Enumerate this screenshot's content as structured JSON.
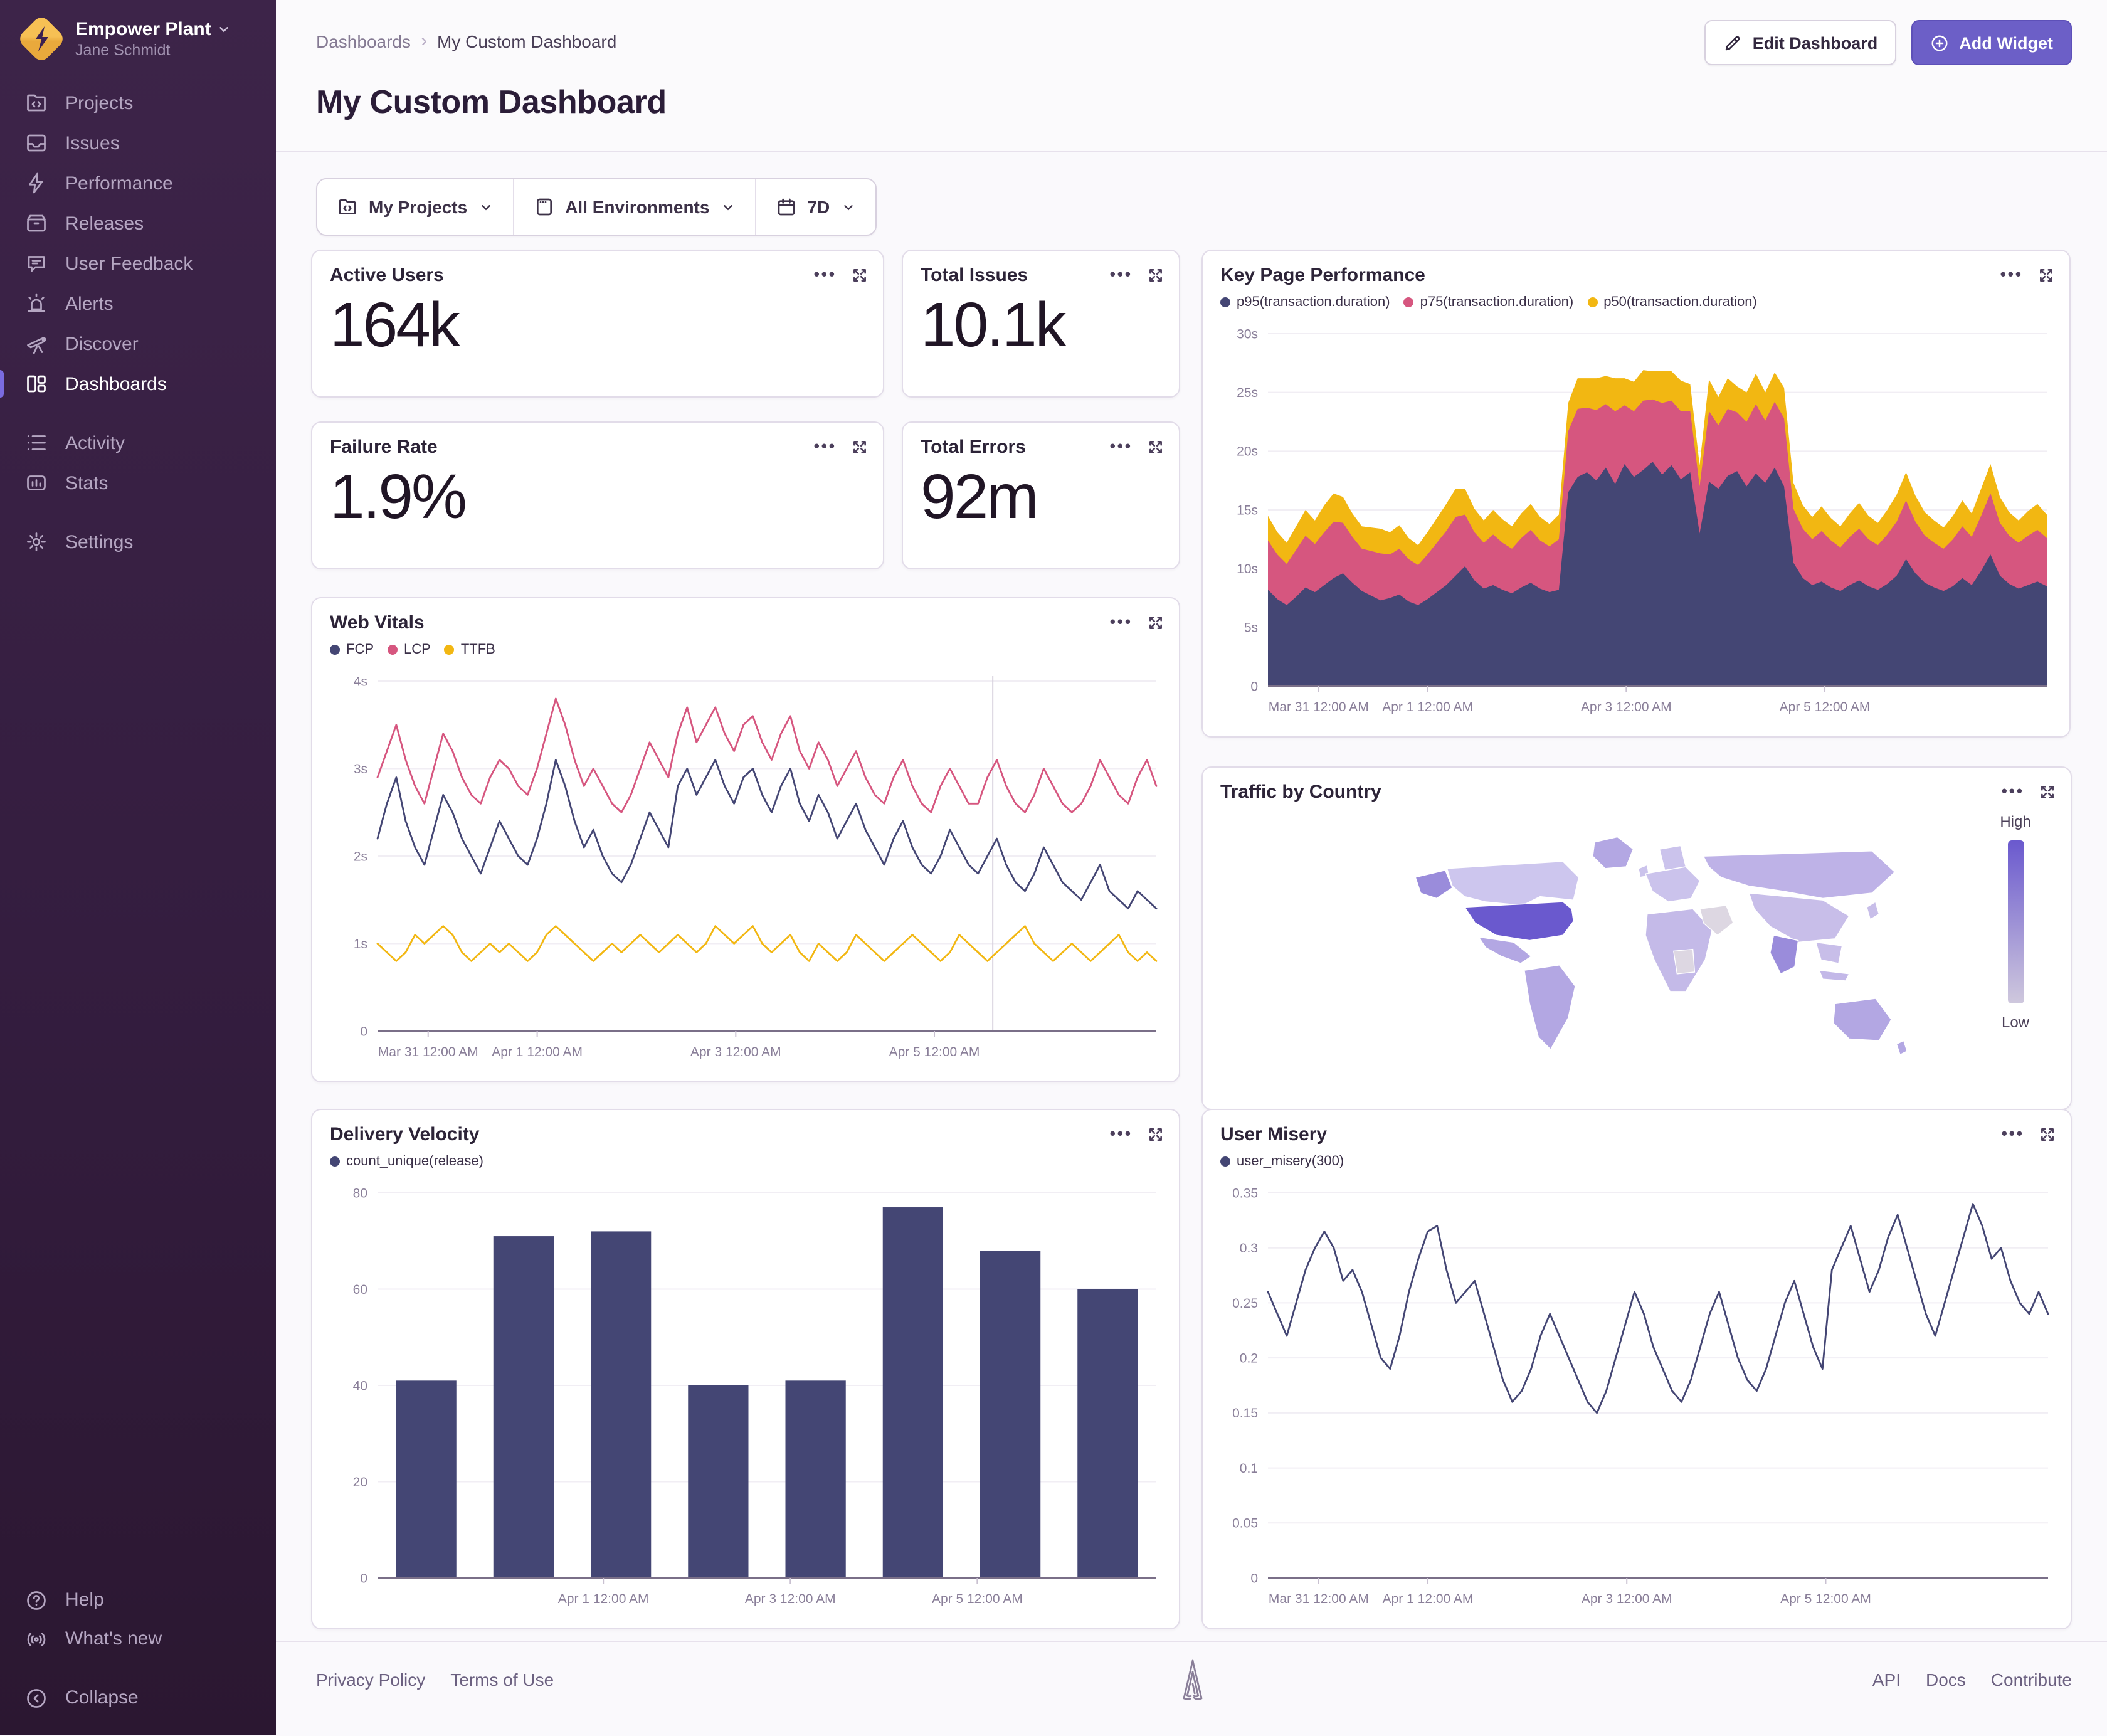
{
  "sidebar": {
    "org": {
      "name": "Empower Plant",
      "user": "Jane Schmidt"
    },
    "groups": [
      {
        "items": [
          {
            "id": "projects",
            "label": "Projects",
            "icon": "projects",
            "active": false
          },
          {
            "id": "issues",
            "label": "Issues",
            "icon": "issues",
            "active": false
          },
          {
            "id": "performance",
            "label": "Performance",
            "icon": "performance",
            "active": false
          },
          {
            "id": "releases",
            "label": "Releases",
            "icon": "releases",
            "active": false
          },
          {
            "id": "user-feedback",
            "label": "User Feedback",
            "icon": "feedback",
            "active": false
          },
          {
            "id": "alerts",
            "label": "Alerts",
            "icon": "alerts",
            "active": false
          },
          {
            "id": "discover",
            "label": "Discover",
            "icon": "discover",
            "active": false
          },
          {
            "id": "dashboards",
            "label": "Dashboards",
            "icon": "dashboards",
            "active": true
          }
        ]
      },
      {
        "items": [
          {
            "id": "activity",
            "label": "Activity",
            "icon": "activity",
            "active": false
          },
          {
            "id": "stats",
            "label": "Stats",
            "icon": "stats",
            "active": false
          }
        ]
      },
      {
        "items": [
          {
            "id": "settings",
            "label": "Settings",
            "icon": "settings",
            "active": false
          }
        ]
      }
    ],
    "bottom": [
      {
        "id": "help",
        "label": "Help",
        "icon": "help"
      },
      {
        "id": "whats-new",
        "label": "What's new",
        "icon": "broadcast"
      },
      {
        "id": "collapse",
        "label": "Collapse",
        "icon": "collapse"
      }
    ]
  },
  "header": {
    "breadcrumb_root": "Dashboards",
    "breadcrumb_current": "My Custom Dashboard",
    "title": "My Custom Dashboard",
    "edit_button": "Edit Dashboard",
    "add_button": "Add Widget"
  },
  "filters": {
    "projects": "My Projects",
    "environments": "All Environments",
    "period": "7D"
  },
  "stats": [
    {
      "title": "Active Users",
      "value": "164k"
    },
    {
      "title": "Total Issues",
      "value": "10.1k"
    },
    {
      "title": "Failure Rate",
      "value": "1.9%"
    },
    {
      "title": "Total Errors",
      "value": "92m"
    }
  ],
  "colors": {
    "accent": "#6C5FC7",
    "navy": "#444674",
    "pink": "#D6567F",
    "yellow": "#F2B712"
  },
  "footer": {
    "left": [
      "Privacy Policy",
      "Terms of Use"
    ],
    "right": [
      "API",
      "Docs",
      "Contribute"
    ]
  },
  "chart_data": [
    {
      "id": "key-page-performance",
      "type": "area",
      "stacked": true,
      "title": "Key Page Performance",
      "ylim": [
        0,
        30
      ],
      "yticks": [
        {
          "v": 0,
          "label": "0"
        },
        {
          "v": 5,
          "label": "5s"
        },
        {
          "v": 10,
          "label": "10s"
        },
        {
          "v": 15,
          "label": "15s"
        },
        {
          "v": 20,
          "label": "20s"
        },
        {
          "v": 25,
          "label": "25s"
        },
        {
          "v": 30,
          "label": "30s"
        }
      ],
      "xticks": [
        {
          "pos": 0.065,
          "label": "Mar 31 12:00 AM"
        },
        {
          "pos": 0.205,
          "label": "Apr 1 12:00 AM"
        },
        {
          "pos": 0.46,
          "label": "Apr 3 12:00 AM"
        },
        {
          "pos": 0.715,
          "label": "Apr 5 12:00 AM"
        }
      ],
      "series": [
        {
          "name": "p95(transaction.duration)",
          "color": "#444674",
          "values": [
            8.2,
            7.4,
            6.9,
            7.6,
            8.4,
            8.0,
            8.6,
            9.2,
            9.6,
            8.8,
            8.1,
            7.7,
            7.3,
            7.5,
            7.8,
            7.2,
            6.9,
            7.4,
            8.0,
            8.6,
            9.4,
            10.2,
            9.0,
            8.3,
            8.6,
            8.2,
            7.9,
            8.4,
            8.8,
            8.3,
            8.0,
            8.2,
            16.5,
            17.8,
            18.2,
            17.5,
            18.6,
            17.2,
            18.9,
            17.8,
            18.4,
            19.1,
            18.0,
            18.8,
            17.6,
            18.2,
            13.0,
            17.4,
            16.8,
            17.9,
            18.3,
            17.0,
            18.1,
            17.3,
            18.6,
            17.0,
            10.5,
            9.2,
            8.6,
            8.9,
            8.4,
            8.1,
            8.6,
            9.0,
            8.5,
            8.2,
            8.7,
            9.4,
            10.8,
            9.6,
            8.8,
            8.4,
            8.1,
            8.5,
            9.2,
            8.6,
            9.8,
            11.2,
            9.4,
            8.7,
            8.3,
            8.6,
            8.9,
            8.5
          ]
        },
        {
          "name": "p75(transaction.duration)",
          "color": "#D6567F",
          "values": [
            4.2,
            3.8,
            3.5,
            4.0,
            4.4,
            4.1,
            4.5,
            4.8,
            4.3,
            3.9,
            3.6,
            3.8,
            4.0,
            3.7,
            3.9,
            3.6,
            3.4,
            3.8,
            4.2,
            4.6,
            5.0,
            4.4,
            4.1,
            3.9,
            4.3,
            4.0,
            3.8,
            4.2,
            4.5,
            4.1,
            3.9,
            4.3,
            5.2,
            5.8,
            5.5,
            6.0,
            5.4,
            6.2,
            5.0,
            5.6,
            5.9,
            5.3,
            6.1,
            5.5,
            5.8,
            5.2,
            4.0,
            6.0,
            5.4,
            5.7,
            5.0,
            5.5,
            5.9,
            5.3,
            5.6,
            5.8,
            4.6,
            4.2,
            3.9,
            4.3,
            4.0,
            3.7,
            4.1,
            4.4,
            4.0,
            3.8,
            4.2,
            4.6,
            5.0,
            4.4,
            4.0,
            3.8,
            3.6,
            4.0,
            4.4,
            4.1,
            4.7,
            5.2,
            4.5,
            4.1,
            3.9,
            4.2,
            4.4,
            4.1
          ]
        },
        {
          "name": "p50(transaction.duration)",
          "color": "#F2B712",
          "values": [
            2.1,
            1.9,
            1.8,
            2.0,
            2.2,
            2.0,
            2.3,
            2.4,
            2.2,
            2.0,
            1.9,
            2.0,
            2.1,
            1.9,
            2.0,
            1.8,
            1.7,
            1.9,
            2.1,
            2.3,
            2.4,
            2.2,
            2.0,
            1.9,
            2.1,
            2.0,
            1.9,
            2.1,
            2.2,
            2.0,
            1.9,
            2.1,
            2.4,
            2.6,
            2.5,
            2.7,
            2.4,
            2.8,
            2.3,
            2.5,
            2.6,
            2.4,
            2.7,
            2.5,
            2.6,
            2.3,
            1.8,
            2.7,
            2.4,
            2.6,
            2.2,
            2.5,
            2.6,
            2.4,
            2.5,
            2.6,
            2.2,
            2.0,
            1.9,
            2.1,
            1.9,
            1.8,
            2.0,
            2.2,
            2.0,
            1.9,
            2.1,
            2.3,
            2.4,
            2.2,
            2.0,
            1.9,
            1.8,
            2.0,
            2.2,
            2.0,
            2.3,
            2.5,
            2.2,
            2.0,
            1.9,
            2.1,
            2.2,
            2.0
          ]
        }
      ]
    },
    {
      "id": "web-vitals",
      "type": "line",
      "title": "Web Vitals",
      "ylim": [
        0,
        4
      ],
      "marker_x": 0.79,
      "yticks": [
        {
          "v": 0,
          "label": "0"
        },
        {
          "v": 1,
          "label": "1s"
        },
        {
          "v": 2,
          "label": "2s"
        },
        {
          "v": 3,
          "label": "3s"
        },
        {
          "v": 4,
          "label": "4s"
        }
      ],
      "xticks": [
        {
          "pos": 0.065,
          "label": "Mar 31 12:00 AM"
        },
        {
          "pos": 0.205,
          "label": "Apr 1 12:00 AM"
        },
        {
          "pos": 0.46,
          "label": "Apr 3 12:00 AM"
        },
        {
          "pos": 0.715,
          "label": "Apr 5 12:00 AM"
        }
      ],
      "series": [
        {
          "name": "LCP",
          "color": "#D6567F",
          "values": [
            2.9,
            3.2,
            3.5,
            3.1,
            2.8,
            2.6,
            3.0,
            3.4,
            3.2,
            2.9,
            2.7,
            2.6,
            2.9,
            3.1,
            3.0,
            2.8,
            2.7,
            3.0,
            3.4,
            3.8,
            3.5,
            3.1,
            2.8,
            3.0,
            2.8,
            2.6,
            2.5,
            2.7,
            3.0,
            3.3,
            3.1,
            2.9,
            3.4,
            3.7,
            3.3,
            3.5,
            3.7,
            3.4,
            3.2,
            3.5,
            3.6,
            3.3,
            3.1,
            3.4,
            3.6,
            3.2,
            3.0,
            3.3,
            3.1,
            2.8,
            3.0,
            3.2,
            2.9,
            2.7,
            2.6,
            2.9,
            3.1,
            2.8,
            2.6,
            2.5,
            2.8,
            3.0,
            2.8,
            2.6,
            2.6,
            2.9,
            3.1,
            2.8,
            2.6,
            2.5,
            2.7,
            3.0,
            2.8,
            2.6,
            2.5,
            2.6,
            2.8,
            3.1,
            2.9,
            2.7,
            2.6,
            2.9,
            3.1,
            2.8
          ]
        },
        {
          "name": "FCP",
          "color": "#444674",
          "values": [
            2.2,
            2.6,
            2.9,
            2.4,
            2.1,
            1.9,
            2.3,
            2.7,
            2.5,
            2.2,
            2.0,
            1.8,
            2.1,
            2.4,
            2.2,
            2.0,
            1.9,
            2.2,
            2.6,
            3.1,
            2.8,
            2.4,
            2.1,
            2.3,
            2.0,
            1.8,
            1.7,
            1.9,
            2.2,
            2.5,
            2.3,
            2.1,
            2.8,
            3.0,
            2.7,
            2.9,
            3.1,
            2.8,
            2.6,
            2.9,
            3.0,
            2.7,
            2.5,
            2.8,
            3.0,
            2.6,
            2.4,
            2.7,
            2.5,
            2.2,
            2.4,
            2.6,
            2.3,
            2.1,
            1.9,
            2.2,
            2.4,
            2.1,
            1.9,
            1.8,
            2.0,
            2.3,
            2.1,
            1.9,
            1.8,
            2.0,
            2.2,
            1.9,
            1.7,
            1.6,
            1.8,
            2.1,
            1.9,
            1.7,
            1.6,
            1.5,
            1.7,
            1.9,
            1.6,
            1.5,
            1.4,
            1.6,
            1.5,
            1.4
          ]
        },
        {
          "name": "TTFB",
          "color": "#F2B712",
          "values": [
            1.0,
            0.9,
            0.8,
            0.9,
            1.1,
            1.0,
            1.1,
            1.2,
            1.1,
            0.9,
            0.8,
            0.9,
            1.0,
            0.9,
            1.0,
            0.9,
            0.8,
            0.9,
            1.1,
            1.2,
            1.1,
            1.0,
            0.9,
            0.8,
            0.9,
            1.0,
            0.9,
            1.0,
            1.1,
            1.0,
            0.9,
            1.0,
            1.1,
            1.0,
            0.9,
            1.0,
            1.2,
            1.1,
            1.0,
            1.1,
            1.2,
            1.0,
            0.9,
            1.0,
            1.1,
            0.9,
            0.8,
            1.0,
            0.9,
            0.8,
            0.9,
            1.1,
            1.0,
            0.9,
            0.8,
            0.9,
            1.0,
            1.1,
            1.0,
            0.9,
            0.8,
            0.9,
            1.1,
            1.0,
            0.9,
            0.8,
            0.9,
            1.0,
            1.1,
            1.2,
            1.0,
            0.9,
            0.8,
            0.9,
            1.0,
            0.9,
            0.8,
            0.9,
            1.0,
            1.1,
            0.9,
            0.8,
            0.9,
            0.8
          ]
        }
      ],
      "legend_order": [
        "FCP",
        "LCP",
        "TTFB"
      ]
    },
    {
      "id": "delivery-velocity",
      "type": "bar",
      "title": "Delivery Velocity",
      "ylim": [
        0,
        80
      ],
      "yticks": [
        {
          "v": 0,
          "label": "0"
        },
        {
          "v": 20,
          "label": "20"
        },
        {
          "v": 40,
          "label": "40"
        },
        {
          "v": 60,
          "label": "60"
        },
        {
          "v": 80,
          "label": "80"
        }
      ],
      "xticks": [
        {
          "pos": 0.29,
          "label": "Apr 1 12:00 AM"
        },
        {
          "pos": 0.53,
          "label": "Apr 3 12:00 AM"
        },
        {
          "pos": 0.77,
          "label": "Apr 5 12:00 AM"
        }
      ],
      "series": [
        {
          "name": "count_unique(release)",
          "color": "#444674",
          "values": [
            41,
            71,
            72,
            40,
            41,
            77,
            68,
            60
          ]
        }
      ]
    },
    {
      "id": "user-misery",
      "type": "line",
      "title": "User Misery",
      "ylim": [
        0,
        0.35
      ],
      "yticks": [
        {
          "v": 0,
          "label": "0"
        },
        {
          "v": 0.05,
          "label": "0.05"
        },
        {
          "v": 0.1,
          "label": "0.1"
        },
        {
          "v": 0.15,
          "label": "0.15"
        },
        {
          "v": 0.2,
          "label": "0.2"
        },
        {
          "v": 0.25,
          "label": "0.25"
        },
        {
          "v": 0.3,
          "label": "0.3"
        },
        {
          "v": 0.35,
          "label": "0.35"
        }
      ],
      "xticks": [
        {
          "pos": 0.065,
          "label": "Mar 31 12:00 AM"
        },
        {
          "pos": 0.205,
          "label": "Apr 1 12:00 AM"
        },
        {
          "pos": 0.46,
          "label": "Apr 3 12:00 AM"
        },
        {
          "pos": 0.715,
          "label": "Apr 5 12:00 AM"
        }
      ],
      "series": [
        {
          "name": "user_misery(300)",
          "color": "#444674",
          "values": [
            0.26,
            0.24,
            0.22,
            0.25,
            0.28,
            0.3,
            0.315,
            0.3,
            0.27,
            0.28,
            0.26,
            0.23,
            0.2,
            0.19,
            0.22,
            0.26,
            0.29,
            0.315,
            0.32,
            0.28,
            0.25,
            0.26,
            0.27,
            0.24,
            0.21,
            0.18,
            0.16,
            0.17,
            0.19,
            0.22,
            0.24,
            0.22,
            0.2,
            0.18,
            0.16,
            0.15,
            0.17,
            0.2,
            0.23,
            0.26,
            0.24,
            0.21,
            0.19,
            0.17,
            0.16,
            0.18,
            0.21,
            0.24,
            0.26,
            0.23,
            0.2,
            0.18,
            0.17,
            0.19,
            0.22,
            0.25,
            0.27,
            0.24,
            0.21,
            0.19,
            0.28,
            0.3,
            0.32,
            0.29,
            0.26,
            0.28,
            0.31,
            0.33,
            0.3,
            0.27,
            0.24,
            0.22,
            0.25,
            0.28,
            0.31,
            0.34,
            0.32,
            0.29,
            0.3,
            0.27,
            0.25,
            0.24,
            0.26,
            0.24
          ]
        }
      ]
    },
    {
      "id": "traffic-by-country",
      "type": "choropleth",
      "title": "Traffic by Country",
      "legend": {
        "high_label": "High",
        "low_label": "Low",
        "top_color": "#6A59CE",
        "bottom_color": "#CFC8DD"
      },
      "regions": {
        "usa": "#6A59CE",
        "canada": "#CDC6EE",
        "alaska": "#9A8CDB",
        "greenland": "#B3A7E3",
        "mexico": "#B3A7E3",
        "south_america": "#B3A7E3",
        "europe": "#CBC3EC",
        "scandinavia": "#CBC3EC",
        "uk": "#CBC3EC",
        "africa": "#C4BAE8",
        "africa_central": "#DDD7E2",
        "middle_east": "#DDD7E2",
        "russia": "#BEB2E7",
        "central_asia": "#C8BEE9",
        "india": "#9A8CDB",
        "se_asia": "#C8BEE9",
        "indonesia": "#C3B8E8",
        "japan": "#C8BEE9",
        "australia": "#B3A7E3",
        "new_zealand": "#B3A7E3"
      }
    }
  ]
}
